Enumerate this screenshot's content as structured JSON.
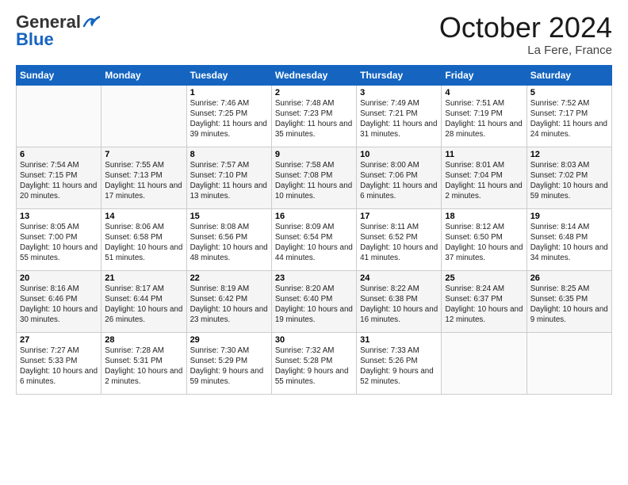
{
  "header": {
    "logo_general": "General",
    "logo_blue": "Blue",
    "month_title": "October 2024",
    "subtitle": "La Fere, France"
  },
  "days_of_week": [
    "Sunday",
    "Monday",
    "Tuesday",
    "Wednesday",
    "Thursday",
    "Friday",
    "Saturday"
  ],
  "weeks": [
    [
      {
        "day": "",
        "info": ""
      },
      {
        "day": "",
        "info": ""
      },
      {
        "day": "1",
        "info": "Sunrise: 7:46 AM\nSunset: 7:25 PM\nDaylight: 11 hours and 39 minutes."
      },
      {
        "day": "2",
        "info": "Sunrise: 7:48 AM\nSunset: 7:23 PM\nDaylight: 11 hours and 35 minutes."
      },
      {
        "day": "3",
        "info": "Sunrise: 7:49 AM\nSunset: 7:21 PM\nDaylight: 11 hours and 31 minutes."
      },
      {
        "day": "4",
        "info": "Sunrise: 7:51 AM\nSunset: 7:19 PM\nDaylight: 11 hours and 28 minutes."
      },
      {
        "day": "5",
        "info": "Sunrise: 7:52 AM\nSunset: 7:17 PM\nDaylight: 11 hours and 24 minutes."
      }
    ],
    [
      {
        "day": "6",
        "info": "Sunrise: 7:54 AM\nSunset: 7:15 PM\nDaylight: 11 hours and 20 minutes."
      },
      {
        "day": "7",
        "info": "Sunrise: 7:55 AM\nSunset: 7:13 PM\nDaylight: 11 hours and 17 minutes."
      },
      {
        "day": "8",
        "info": "Sunrise: 7:57 AM\nSunset: 7:10 PM\nDaylight: 11 hours and 13 minutes."
      },
      {
        "day": "9",
        "info": "Sunrise: 7:58 AM\nSunset: 7:08 PM\nDaylight: 11 hours and 10 minutes."
      },
      {
        "day": "10",
        "info": "Sunrise: 8:00 AM\nSunset: 7:06 PM\nDaylight: 11 hours and 6 minutes."
      },
      {
        "day": "11",
        "info": "Sunrise: 8:01 AM\nSunset: 7:04 PM\nDaylight: 11 hours and 2 minutes."
      },
      {
        "day": "12",
        "info": "Sunrise: 8:03 AM\nSunset: 7:02 PM\nDaylight: 10 hours and 59 minutes."
      }
    ],
    [
      {
        "day": "13",
        "info": "Sunrise: 8:05 AM\nSunset: 7:00 PM\nDaylight: 10 hours and 55 minutes."
      },
      {
        "day": "14",
        "info": "Sunrise: 8:06 AM\nSunset: 6:58 PM\nDaylight: 10 hours and 51 minutes."
      },
      {
        "day": "15",
        "info": "Sunrise: 8:08 AM\nSunset: 6:56 PM\nDaylight: 10 hours and 48 minutes."
      },
      {
        "day": "16",
        "info": "Sunrise: 8:09 AM\nSunset: 6:54 PM\nDaylight: 10 hours and 44 minutes."
      },
      {
        "day": "17",
        "info": "Sunrise: 8:11 AM\nSunset: 6:52 PM\nDaylight: 10 hours and 41 minutes."
      },
      {
        "day": "18",
        "info": "Sunrise: 8:12 AM\nSunset: 6:50 PM\nDaylight: 10 hours and 37 minutes."
      },
      {
        "day": "19",
        "info": "Sunrise: 8:14 AM\nSunset: 6:48 PM\nDaylight: 10 hours and 34 minutes."
      }
    ],
    [
      {
        "day": "20",
        "info": "Sunrise: 8:16 AM\nSunset: 6:46 PM\nDaylight: 10 hours and 30 minutes."
      },
      {
        "day": "21",
        "info": "Sunrise: 8:17 AM\nSunset: 6:44 PM\nDaylight: 10 hours and 26 minutes."
      },
      {
        "day": "22",
        "info": "Sunrise: 8:19 AM\nSunset: 6:42 PM\nDaylight: 10 hours and 23 minutes."
      },
      {
        "day": "23",
        "info": "Sunrise: 8:20 AM\nSunset: 6:40 PM\nDaylight: 10 hours and 19 minutes."
      },
      {
        "day": "24",
        "info": "Sunrise: 8:22 AM\nSunset: 6:38 PM\nDaylight: 10 hours and 16 minutes."
      },
      {
        "day": "25",
        "info": "Sunrise: 8:24 AM\nSunset: 6:37 PM\nDaylight: 10 hours and 12 minutes."
      },
      {
        "day": "26",
        "info": "Sunrise: 8:25 AM\nSunset: 6:35 PM\nDaylight: 10 hours and 9 minutes."
      }
    ],
    [
      {
        "day": "27",
        "info": "Sunrise: 7:27 AM\nSunset: 5:33 PM\nDaylight: 10 hours and 6 minutes."
      },
      {
        "day": "28",
        "info": "Sunrise: 7:28 AM\nSunset: 5:31 PM\nDaylight: 10 hours and 2 minutes."
      },
      {
        "day": "29",
        "info": "Sunrise: 7:30 AM\nSunset: 5:29 PM\nDaylight: 9 hours and 59 minutes."
      },
      {
        "day": "30",
        "info": "Sunrise: 7:32 AM\nSunset: 5:28 PM\nDaylight: 9 hours and 55 minutes."
      },
      {
        "day": "31",
        "info": "Sunrise: 7:33 AM\nSunset: 5:26 PM\nDaylight: 9 hours and 52 minutes."
      },
      {
        "day": "",
        "info": ""
      },
      {
        "day": "",
        "info": ""
      }
    ]
  ]
}
